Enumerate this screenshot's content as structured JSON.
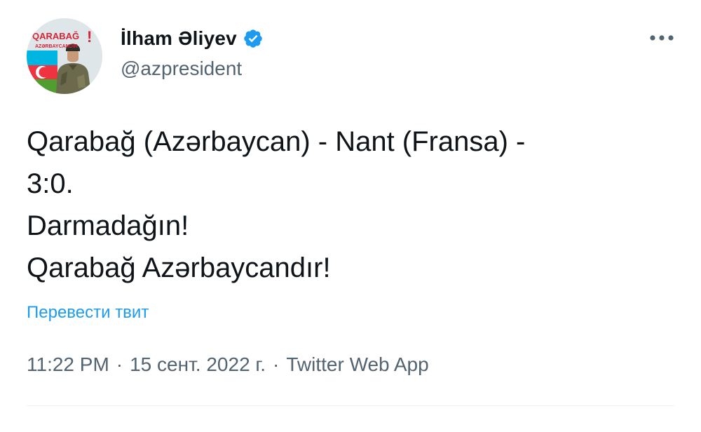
{
  "author": {
    "display_name": "İlham Əliyev",
    "handle": "@azpresident",
    "avatar_caption": "QARABAĞ AZƏRBAYCANDIR!",
    "verified": true
  },
  "tweet": {
    "lines": [
      "Qarabağ (Azərbaycan) - Nant (Fransa) -",
      "3:0.",
      "Darmadağın!",
      "Qarabağ Azərbaycandır!"
    ],
    "translate_label": "Перевести твит",
    "time": "11:22 PM",
    "date": "15 сент. 2022 г.",
    "source": "Twitter Web App",
    "separator": "·"
  },
  "colors": {
    "accent": "#1d9bf0",
    "text": "#0f1419",
    "secondary": "#536471"
  },
  "icons": {
    "verified": "verified-badge-icon",
    "more": "more-horizontal-icon"
  }
}
